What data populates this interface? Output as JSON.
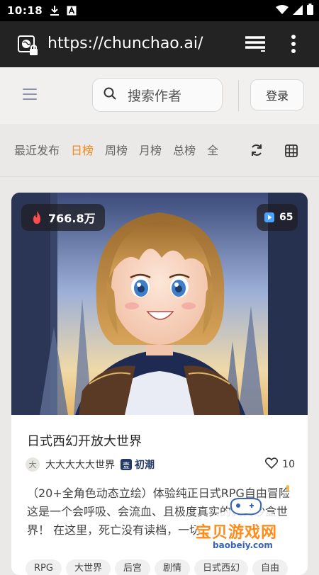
{
  "status_bar": {
    "time": "10:18",
    "icons": [
      "download-icon",
      "text-a-icon",
      "wifi-icon",
      "cell-signal-icon",
      "battery-icon"
    ]
  },
  "browser": {
    "url": "https://chunchao.ai/",
    "icons": [
      "site-info-icon",
      "tabs-icon",
      "overflow-menu-icon"
    ]
  },
  "header": {
    "search_placeholder": "搜索作者",
    "login_label": "登录"
  },
  "filters": {
    "tabs": [
      {
        "label": "最近发布",
        "active": false
      },
      {
        "label": "日榜",
        "active": true
      },
      {
        "label": "周榜",
        "active": false
      },
      {
        "label": "月榜",
        "active": false
      },
      {
        "label": "总榜",
        "active": false
      },
      {
        "label": "全",
        "active": false
      }
    ],
    "active_color": "#f08a1c"
  },
  "card": {
    "hot_count": "766.8万",
    "play_count": "65",
    "title": "日式西幻开放大世界",
    "author_avatar_char": "大",
    "author_name": "大大大大大世界",
    "tier_badge_char": "壹",
    "tier_label": "初潮",
    "like_count": "10",
    "description": "（20+全角色动态立绘）体验纯正日式RPG自由冒险 这是一个会呼吸、会流血、且极度真实的真实沙盒世界！ 在这里，死亡没有读档，一切",
    "tags": [
      "RPG",
      "大世界",
      "后宫",
      "剧情",
      "日式西幻",
      "自由"
    ]
  },
  "watermark": {
    "text": "宝贝游戏网",
    "url": "baobeiy.com"
  }
}
